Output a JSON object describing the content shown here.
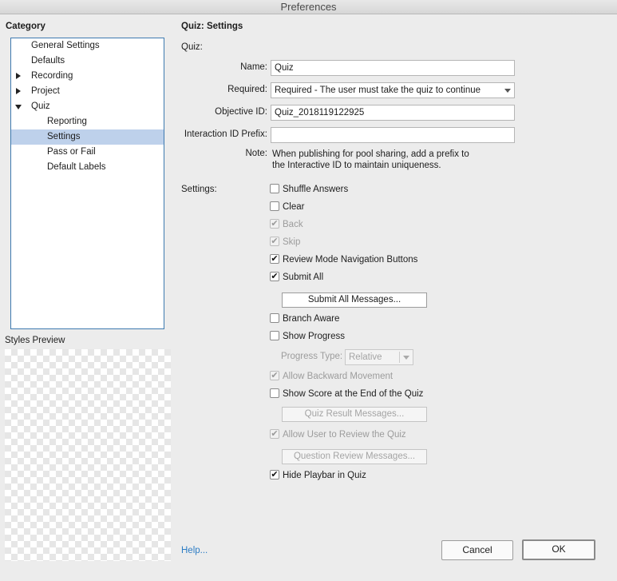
{
  "window": {
    "title": "Preferences"
  },
  "sidebar": {
    "category_label": "Category",
    "items": [
      {
        "label": "General Settings",
        "selected": false
      },
      {
        "label": "Defaults",
        "selected": false
      },
      {
        "label": "Recording",
        "selected": false
      },
      {
        "label": "Project",
        "selected": false
      },
      {
        "label": "Quiz",
        "selected": false
      },
      {
        "label": "Reporting",
        "selected": false
      },
      {
        "label": "Settings",
        "selected": true
      },
      {
        "label": "Pass or Fail",
        "selected": false
      },
      {
        "label": "Default Labels",
        "selected": false
      }
    ],
    "styles_preview_label": "Styles Preview"
  },
  "main": {
    "heading": "Quiz: Settings",
    "quiz_section_label": "Quiz:",
    "name": {
      "label": "Name:",
      "value": "Quiz"
    },
    "required": {
      "label": "Required:",
      "value": "Required - The user must take the quiz to continue"
    },
    "objective_id": {
      "label": "Objective ID:",
      "value": "Quiz_2018119122925"
    },
    "interaction_prefix": {
      "label": "Interaction ID Prefix:",
      "value": ""
    },
    "note": {
      "label": "Note:",
      "line1": "When publishing for pool sharing, add a prefix to",
      "line2": "the Interactive ID to maintain uniqueness."
    },
    "settings_label": "Settings:",
    "settings": {
      "shuffle_answers": {
        "label": "Shuffle Answers",
        "checked": false,
        "enabled": true
      },
      "clear": {
        "label": "Clear",
        "checked": false,
        "enabled": true
      },
      "back": {
        "label": "Back",
        "checked": true,
        "enabled": false
      },
      "skip": {
        "label": "Skip",
        "checked": true,
        "enabled": false
      },
      "review_mode_nav": {
        "label": "Review Mode Navigation Buttons",
        "checked": true,
        "enabled": true
      },
      "submit_all": {
        "label": "Submit All",
        "checked": true,
        "enabled": true
      },
      "submit_all_messages": "Submit All Messages...",
      "branch_aware": {
        "label": "Branch Aware",
        "checked": false,
        "enabled": true
      },
      "show_progress": {
        "label": "Show Progress",
        "checked": false,
        "enabled": true
      },
      "progress_type": {
        "label": "Progress Type:",
        "value": "Relative"
      },
      "allow_backward": {
        "label": "Allow Backward Movement",
        "checked": true,
        "enabled": false
      },
      "show_score": {
        "label": "Show Score at the End of the Quiz",
        "checked": false,
        "enabled": true
      },
      "quiz_result_messages": "Quiz Result Messages...",
      "allow_review": {
        "label": "Allow User to Review the Quiz",
        "checked": true,
        "enabled": false
      },
      "question_review_messages": "Question Review Messages...",
      "hide_playbar": {
        "label": "Hide Playbar in Quiz",
        "checked": true,
        "enabled": true
      }
    }
  },
  "footer": {
    "help": "Help...",
    "cancel": "Cancel",
    "ok": "OK"
  },
  "icons": {
    "check": "✔",
    "expand": "triangle-right-icon",
    "collapse": "triangle-down-icon"
  }
}
